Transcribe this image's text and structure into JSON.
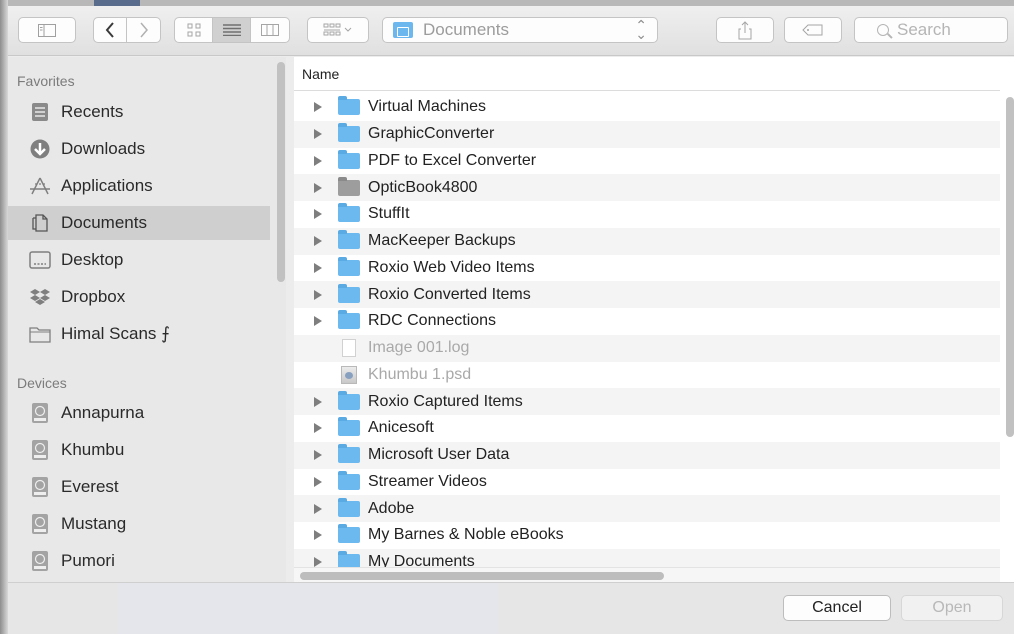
{
  "toolbar": {
    "path_label": "Documents",
    "search_placeholder": "Search",
    "view_modes": [
      "icon-view",
      "list-view",
      "column-view"
    ],
    "active_view": "list-view"
  },
  "sidebar": {
    "favorites_header": "Favorites",
    "favorites": [
      {
        "label": "Recents",
        "icon": "recents-icon"
      },
      {
        "label": "Downloads",
        "icon": "downloads-icon"
      },
      {
        "label": "Applications",
        "icon": "applications-icon"
      },
      {
        "label": "Documents",
        "icon": "documents-icon",
        "selected": true
      },
      {
        "label": "Desktop",
        "icon": "desktop-icon"
      },
      {
        "label": "Dropbox",
        "icon": "dropbox-icon"
      },
      {
        "label": "Himal Scans ⨍",
        "icon": "folder-icon"
      }
    ],
    "devices_header": "Devices",
    "devices": [
      {
        "label": "Annapurna",
        "icon": "disk-icon"
      },
      {
        "label": "Khumbu",
        "icon": "disk-icon"
      },
      {
        "label": "Everest",
        "icon": "disk-icon"
      },
      {
        "label": "Mustang",
        "icon": "disk-icon"
      },
      {
        "label": "Pumori",
        "icon": "disk-icon"
      }
    ]
  },
  "list": {
    "column_header": "Name",
    "rows": [
      {
        "name": "Virtual Machines",
        "kind": "folder"
      },
      {
        "name": "GraphicConverter",
        "kind": "folder"
      },
      {
        "name": "PDF to Excel Converter",
        "kind": "folder"
      },
      {
        "name": "OpticBook4800",
        "kind": "folder-gray"
      },
      {
        "name": "StuffIt",
        "kind": "folder"
      },
      {
        "name": "MacKeeper Backups",
        "kind": "folder"
      },
      {
        "name": "Roxio Web Video Items",
        "kind": "folder"
      },
      {
        "name": "Roxio Converted Items",
        "kind": "folder"
      },
      {
        "name": "RDC Connections",
        "kind": "folder"
      },
      {
        "name": "Image 001.log",
        "kind": "file-dim"
      },
      {
        "name": "Khumbu 1.psd",
        "kind": "psd-dim"
      },
      {
        "name": "Roxio Captured Items",
        "kind": "folder"
      },
      {
        "name": "Anicesoft",
        "kind": "folder"
      },
      {
        "name": "Microsoft User Data",
        "kind": "folder"
      },
      {
        "name": "Streamer Videos",
        "kind": "folder"
      },
      {
        "name": "Adobe",
        "kind": "folder"
      },
      {
        "name": "My Barnes & Noble eBooks",
        "kind": "folder"
      },
      {
        "name": "My Documents",
        "kind": "folder"
      }
    ]
  },
  "footer": {
    "cancel_label": "Cancel",
    "open_label": "Open"
  }
}
